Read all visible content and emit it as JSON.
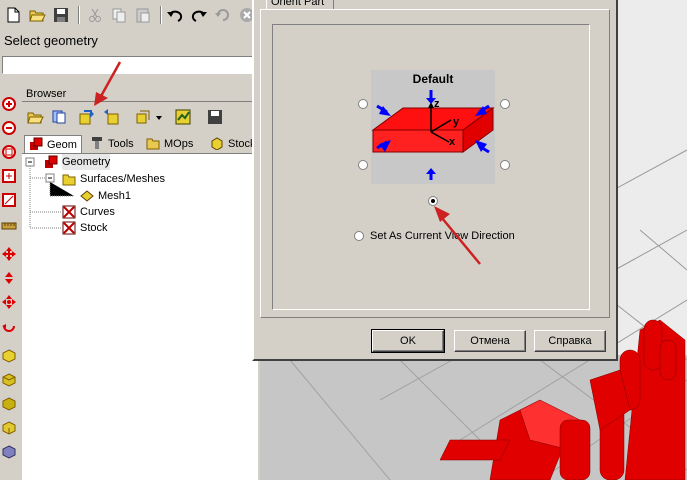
{
  "toolbar": {
    "icons": [
      "new-icon",
      "open-icon",
      "save-icon",
      "cut-icon",
      "copy-icon",
      "paste-icon",
      "undo-icon",
      "redo-icon",
      "refresh-icon",
      "cancel-icon"
    ]
  },
  "prompt": {
    "text": "Select geometry"
  },
  "browser": {
    "title": "Browser",
    "tabs": [
      {
        "label": "Geom",
        "icon": "geometry-icon",
        "active": true
      },
      {
        "label": "Tools",
        "icon": "tools-icon",
        "active": false
      },
      {
        "label": "MOps",
        "icon": "mops-folder-icon",
        "active": false
      },
      {
        "label": "Stock",
        "icon": "stock-icon",
        "active": false
      }
    ],
    "tree": [
      {
        "label": "Geometry",
        "icon": "geometry-icon",
        "level": 0
      },
      {
        "label": "Surfaces/Meshes",
        "icon": "folder-icon",
        "level": 1
      },
      {
        "label": "Mesh1",
        "icon": "mesh-icon",
        "level": 2
      },
      {
        "label": "Curves",
        "icon": "curves-icon",
        "level": 1
      },
      {
        "label": "Stock",
        "icon": "stock-icon",
        "level": 1
      }
    ]
  },
  "dialog": {
    "tab_label": "Orient Part",
    "preview_title": "Default",
    "axis_labels": [
      "z",
      "y",
      "x"
    ],
    "current_view_label": "Set As Current View Direction",
    "buttons": {
      "ok": "OK",
      "cancel": "Отмена",
      "help": "Справка"
    }
  },
  "colors": {
    "part": "#ff0000",
    "arrow": "#0000ff",
    "highlight_arrow": "#cc2222"
  }
}
